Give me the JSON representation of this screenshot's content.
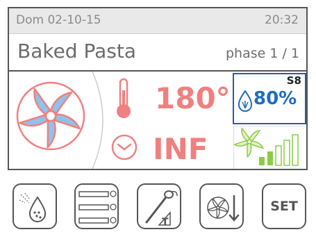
{
  "status_bar": {
    "date": "Dom 02-10-15",
    "time": "20:32"
  },
  "recipe": {
    "name": "Baked Pasta",
    "phase": "phase 1 / 1"
  },
  "temperature": {
    "value": "180°"
  },
  "humidity": {
    "tag": "S8",
    "value": "80%"
  },
  "timer": {
    "value": "INF"
  },
  "fan_speed": {
    "level_fraction": 1.0
  },
  "buttons": {
    "set_label": "SET"
  },
  "icons": {
    "fan": "fan-icon",
    "thermometer": "thermometer-icon",
    "water_drop": "water-drop-icon",
    "timer": "timer-icon",
    "fan_speed": "fan-speed-icon",
    "steam": "steam-icon",
    "programs": "programs-icon",
    "probe": "core-probe-icon",
    "cooldown": "fan-cooldown-icon"
  },
  "colors": {
    "accent": "#ef8080",
    "blue": "#1e6dc0",
    "green": "#8ccb46",
    "frame": "#555555"
  }
}
